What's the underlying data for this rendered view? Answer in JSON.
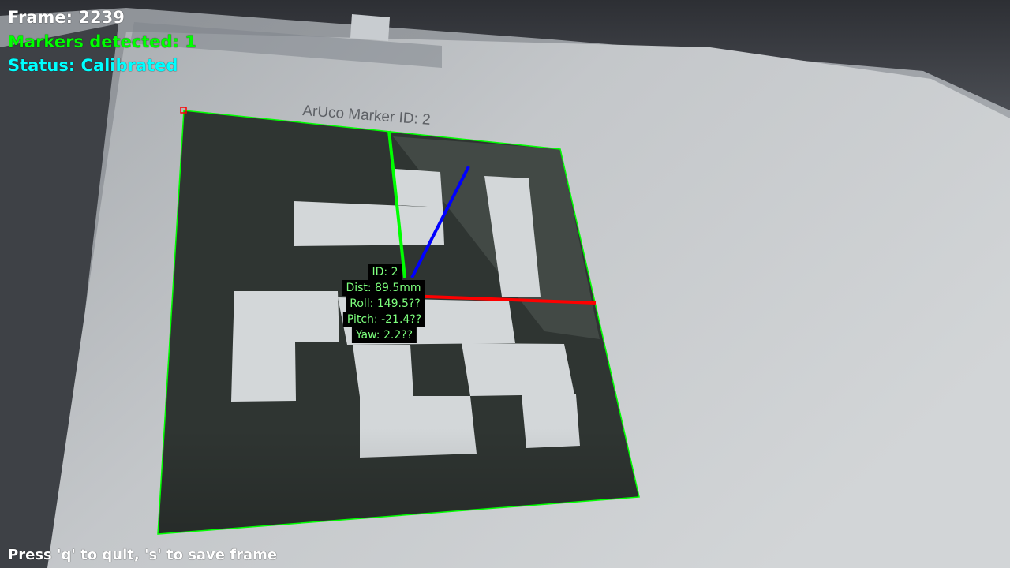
{
  "hud": {
    "frame": "Frame: 2239",
    "markers": "Markers detected: 1",
    "status": "Status: Calibrated",
    "hint": "Press 'q' to quit, 's' to save frame"
  },
  "paper": {
    "caption": "ArUco Marker ID: 2"
  },
  "marker": {
    "id_label": "ID: 2",
    "distance": "Dist: 89.5mm",
    "roll": "Roll: 149.5??",
    "pitch": "Pitch: -21.4??",
    "yaw": "Yaw: 2.2??"
  },
  "colors": {
    "outline": "#00ff00",
    "x_axis": "#ff0000",
    "y_axis": "#00ff00",
    "z_axis": "#0000ff",
    "frame_text": "#ffffff",
    "markers_text": "#00ff00",
    "status_text": "#00ffff"
  }
}
